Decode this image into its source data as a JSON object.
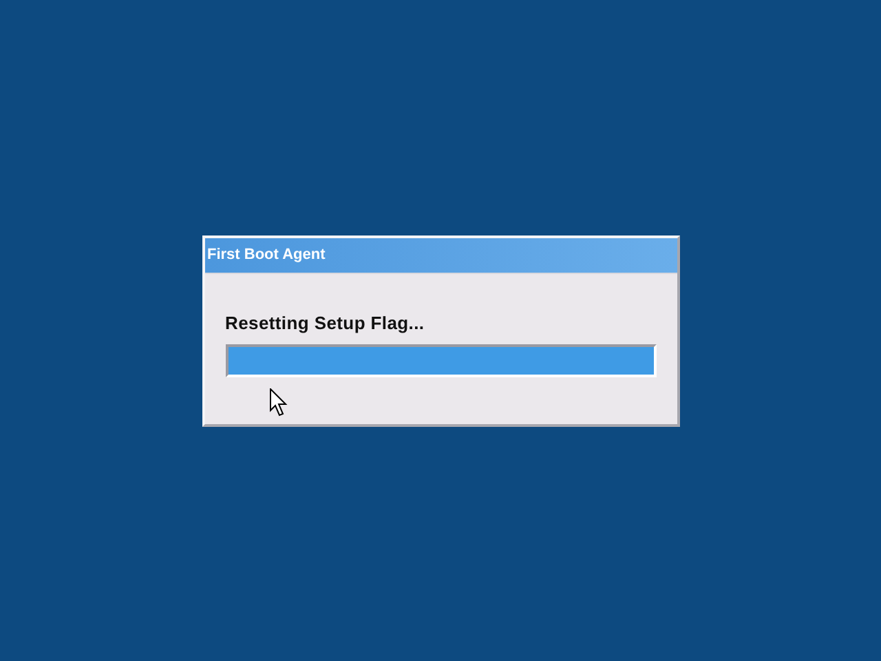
{
  "window": {
    "title": "First Boot Agent"
  },
  "status": {
    "message": "Resetting Setup Flag..."
  },
  "progress": {
    "level": 1
  }
}
